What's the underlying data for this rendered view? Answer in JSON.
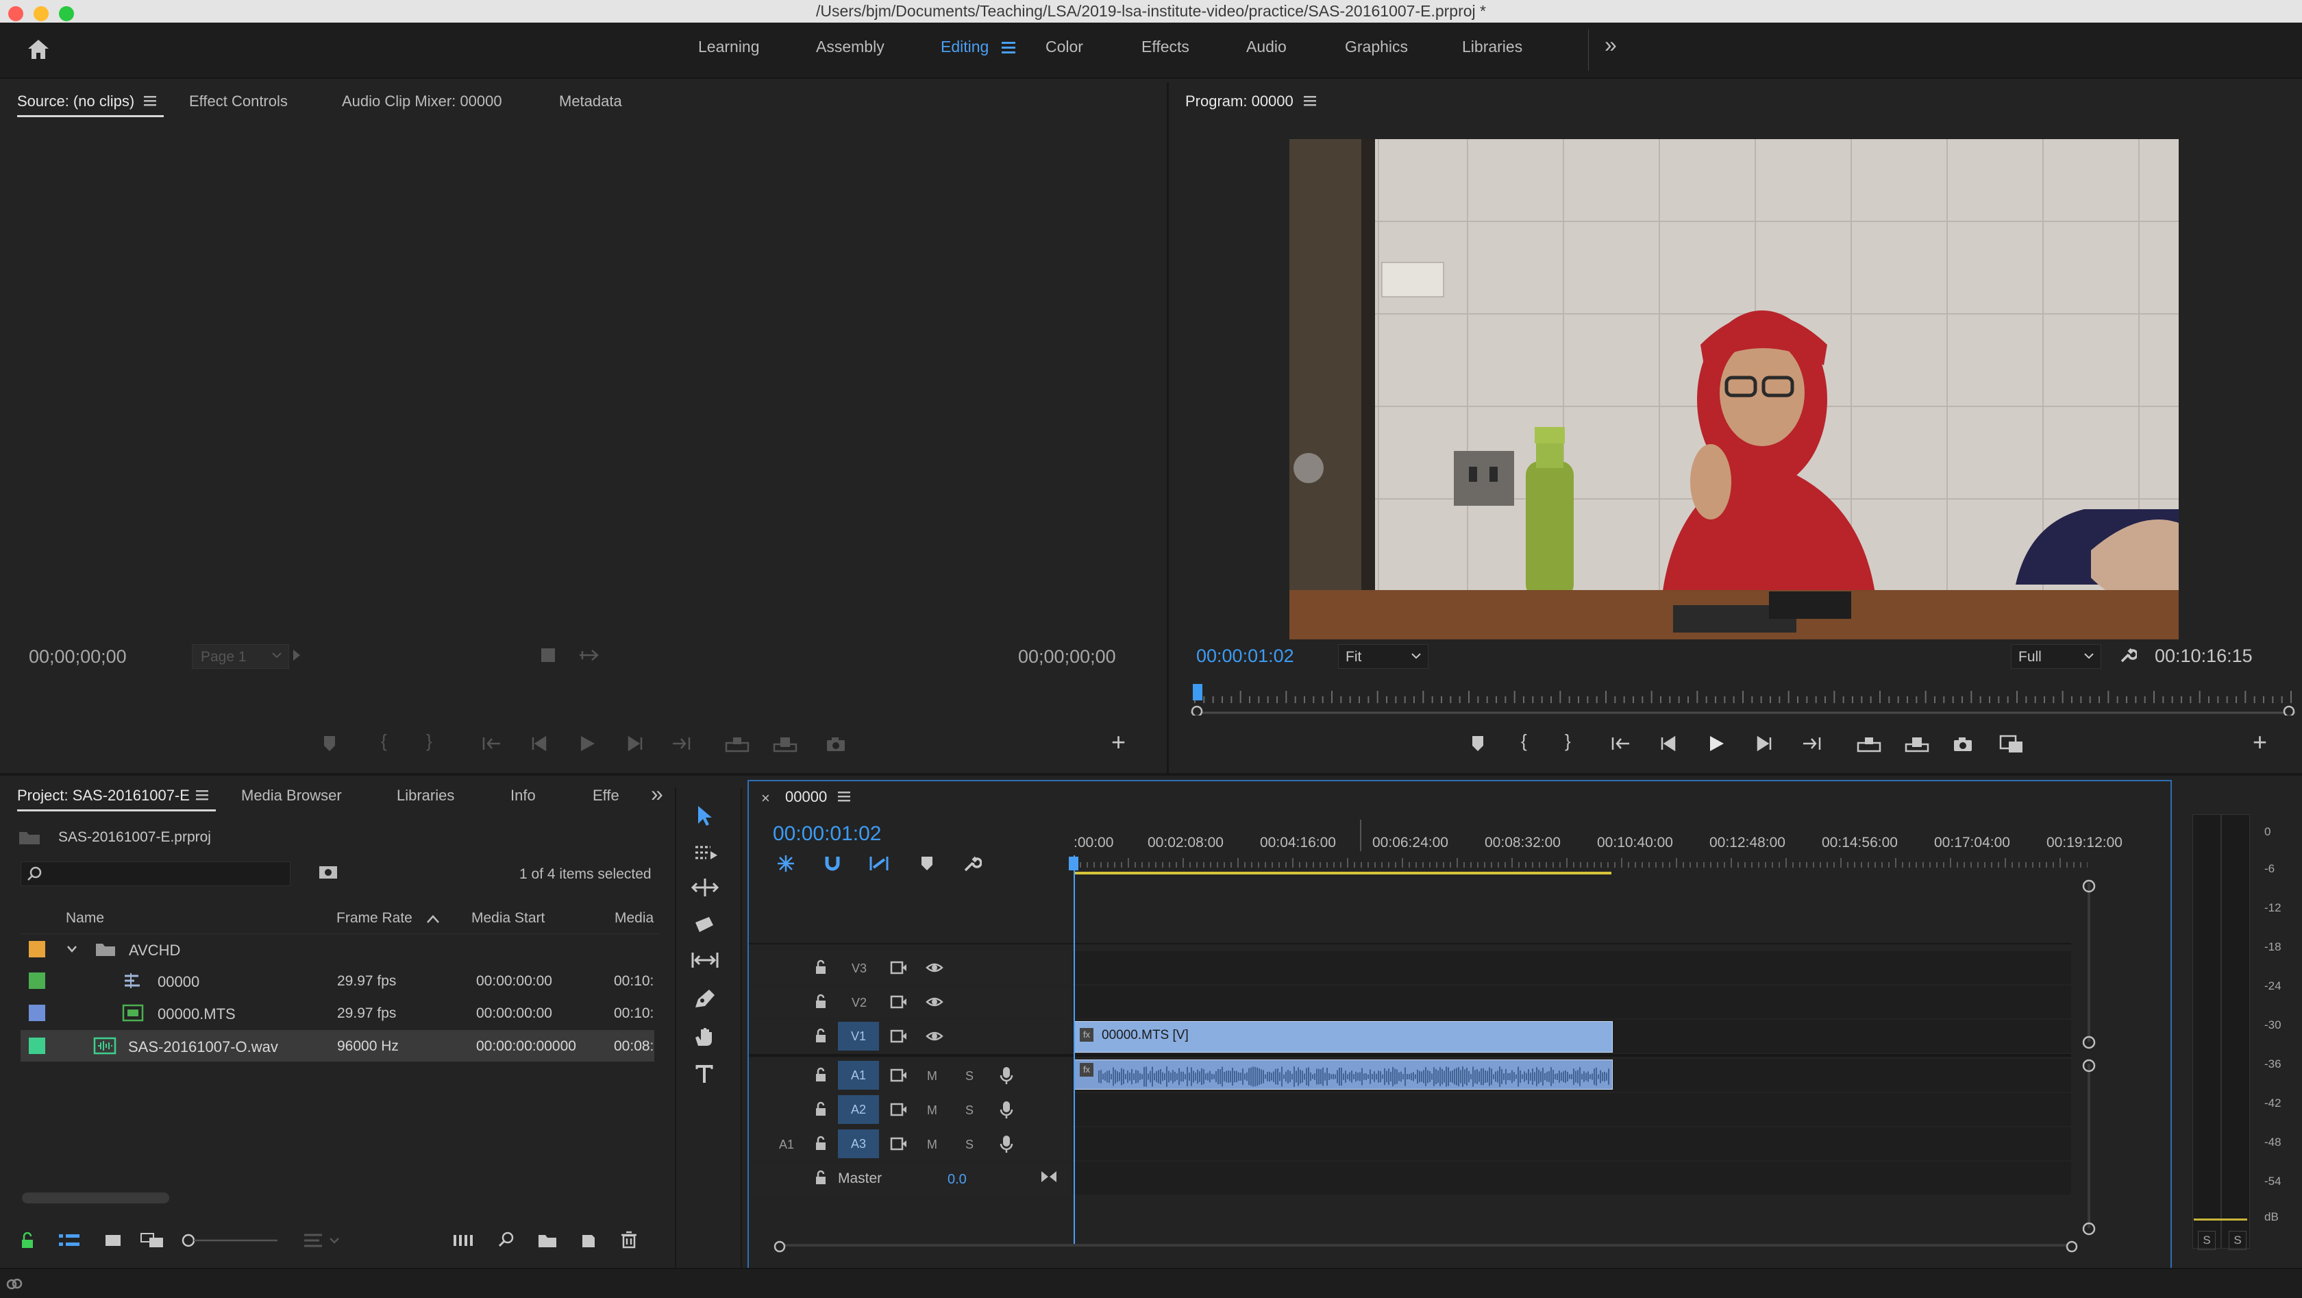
{
  "window": {
    "title": "/Users/bjm/Documents/Teaching/LSA/2019-lsa-institute-video/practice/SAS-20161007-E.prproj *",
    "traffic_colors": [
      "#ff5f57",
      "#febc2e",
      "#28c840"
    ]
  },
  "workspaces": {
    "items": [
      "Learning",
      "Assembly",
      "Editing",
      "Color",
      "Effects",
      "Audio",
      "Graphics",
      "Libraries"
    ],
    "active": "Editing",
    "overflow": "»"
  },
  "source_panel": {
    "tabs": [
      "Source: (no clips)",
      "Effect Controls",
      "Audio Clip Mixer: 00000",
      "Metadata"
    ],
    "timecode_in": "00;00;00;00",
    "timecode_out": "00;00;00;00",
    "page_label": "Page 1"
  },
  "program_panel": {
    "tab": "Program: 00000",
    "timecode": "00:00:01:02",
    "duration": "00:10:16:15",
    "fit": "Fit",
    "quality": "Full",
    "playhead_fraction": 0.002
  },
  "project_panel": {
    "tabs": [
      "Project: SAS-20161007-E",
      "Media Browser",
      "Libraries",
      "Info",
      "Effe"
    ],
    "project_file": "SAS-20161007-E.prproj",
    "search_placeholder": "",
    "selection_status": "1 of 4 items selected",
    "columns": [
      "Name",
      "Frame Rate",
      "Media Start",
      "Media"
    ],
    "rows": [
      {
        "name": "AVCHD",
        "type": "folder",
        "frame_rate": "",
        "media_start": "",
        "media": "",
        "color": "#e8a33a"
      },
      {
        "name": "00000",
        "type": "sequence",
        "frame_rate": "29.97 fps",
        "media_start": "00:00:00:00",
        "media": "00:10:",
        "color": "#4caf50"
      },
      {
        "name": "00000.MTS",
        "type": "video",
        "frame_rate": "29.97 fps",
        "media_start": "00:00:00:00",
        "media": "00:10:",
        "color": "#6f8fd8"
      },
      {
        "name": "SAS-20161007-O.wav",
        "type": "audio",
        "frame_rate": "96000 Hz",
        "media_start": "00:00:00:00000",
        "media": "00:08:",
        "color": "#3ecf8e"
      }
    ]
  },
  "timeline": {
    "tab": "00000",
    "close": "×",
    "timecode": "00:00:01:02",
    "ruler": [
      ":00:00",
      "00:02:08:00",
      "00:04:16:00",
      "00:06:24:00",
      "00:08:32:00",
      "00:10:40:00",
      "00:12:48:00",
      "00:14:56:00",
      "00:17:04:00",
      "00:19:12:00"
    ],
    "video_tracks": [
      "V3",
      "V2",
      "V1"
    ],
    "audio_tracks": [
      "A1",
      "A2",
      "A3"
    ],
    "source_patch": "A1",
    "mute": "M",
    "solo": "S",
    "master_label": "Master",
    "master_value": "0.0",
    "video_clip": "00000.MTS [V]",
    "fx_badge": "fx",
    "clip_fraction": 0.5
  },
  "audio_meter": {
    "scale": [
      "0",
      "-6",
      "-12",
      "-18",
      "-24",
      "-30",
      "-36",
      "-42",
      "-48",
      "-54",
      "dB"
    ],
    "solo_buttons": [
      "S",
      "S"
    ]
  },
  "icons": [
    "home-icon",
    "selection-tool-icon",
    "track-select-icon",
    "ripple-edit-icon",
    "razor-icon",
    "slip-icon",
    "pen-icon",
    "hand-icon",
    "type-icon"
  ]
}
